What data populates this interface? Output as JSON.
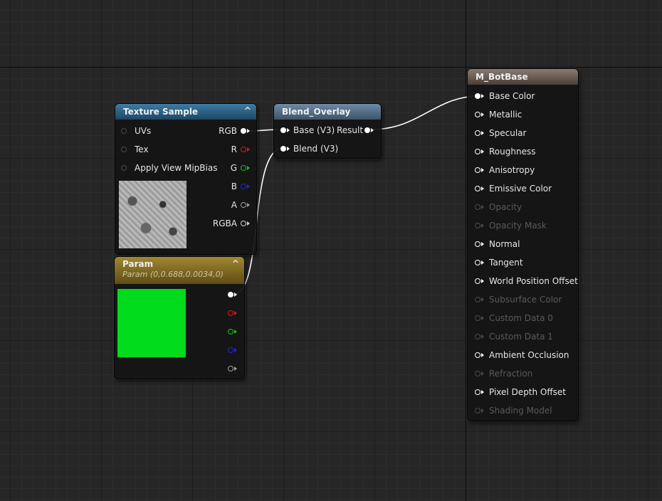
{
  "texture_sample": {
    "title": "Texture Sample",
    "inputs": [
      "UVs",
      "Tex",
      "Apply View MipBias"
    ],
    "outputs": [
      "RGB",
      "R",
      "G",
      "B",
      "A",
      "RGBA"
    ]
  },
  "blend_overlay": {
    "title": "Blend_Overlay",
    "inputs": [
      "Base (V3)",
      "Blend (V3)"
    ],
    "output": "Result"
  },
  "param": {
    "title": "Param",
    "subtitle": "Param (0,0.688,0.0034,0)",
    "color": "#00dc1c"
  },
  "material": {
    "title": "M_BotBase",
    "inputs": [
      {
        "label": "Base Color",
        "enabled": true
      },
      {
        "label": "Metallic",
        "enabled": true
      },
      {
        "label": "Specular",
        "enabled": true
      },
      {
        "label": "Roughness",
        "enabled": true
      },
      {
        "label": "Anisotropy",
        "enabled": true
      },
      {
        "label": "Emissive Color",
        "enabled": true
      },
      {
        "label": "Opacity",
        "enabled": false
      },
      {
        "label": "Opacity Mask",
        "enabled": false
      },
      {
        "label": "Normal",
        "enabled": true
      },
      {
        "label": "Tangent",
        "enabled": true
      },
      {
        "label": "World Position Offset",
        "enabled": true
      },
      {
        "label": "Subsurface Color",
        "enabled": false
      },
      {
        "label": "Custom Data 0",
        "enabled": false
      },
      {
        "label": "Custom Data 1",
        "enabled": false
      },
      {
        "label": "Ambient Occlusion",
        "enabled": true
      },
      {
        "label": "Refraction",
        "enabled": false
      },
      {
        "label": "Pixel Depth Offset",
        "enabled": true
      },
      {
        "label": "Shading Model",
        "enabled": false
      }
    ]
  },
  "colors": {
    "background": "#262626",
    "pin_white": "#ffffff",
    "pin_red": "#e01818",
    "pin_green": "#12c712",
    "pin_blue": "#1c2ad6",
    "pin_gray": "#a0a0a0",
    "pin_disabled": "#4a4a4a"
  }
}
